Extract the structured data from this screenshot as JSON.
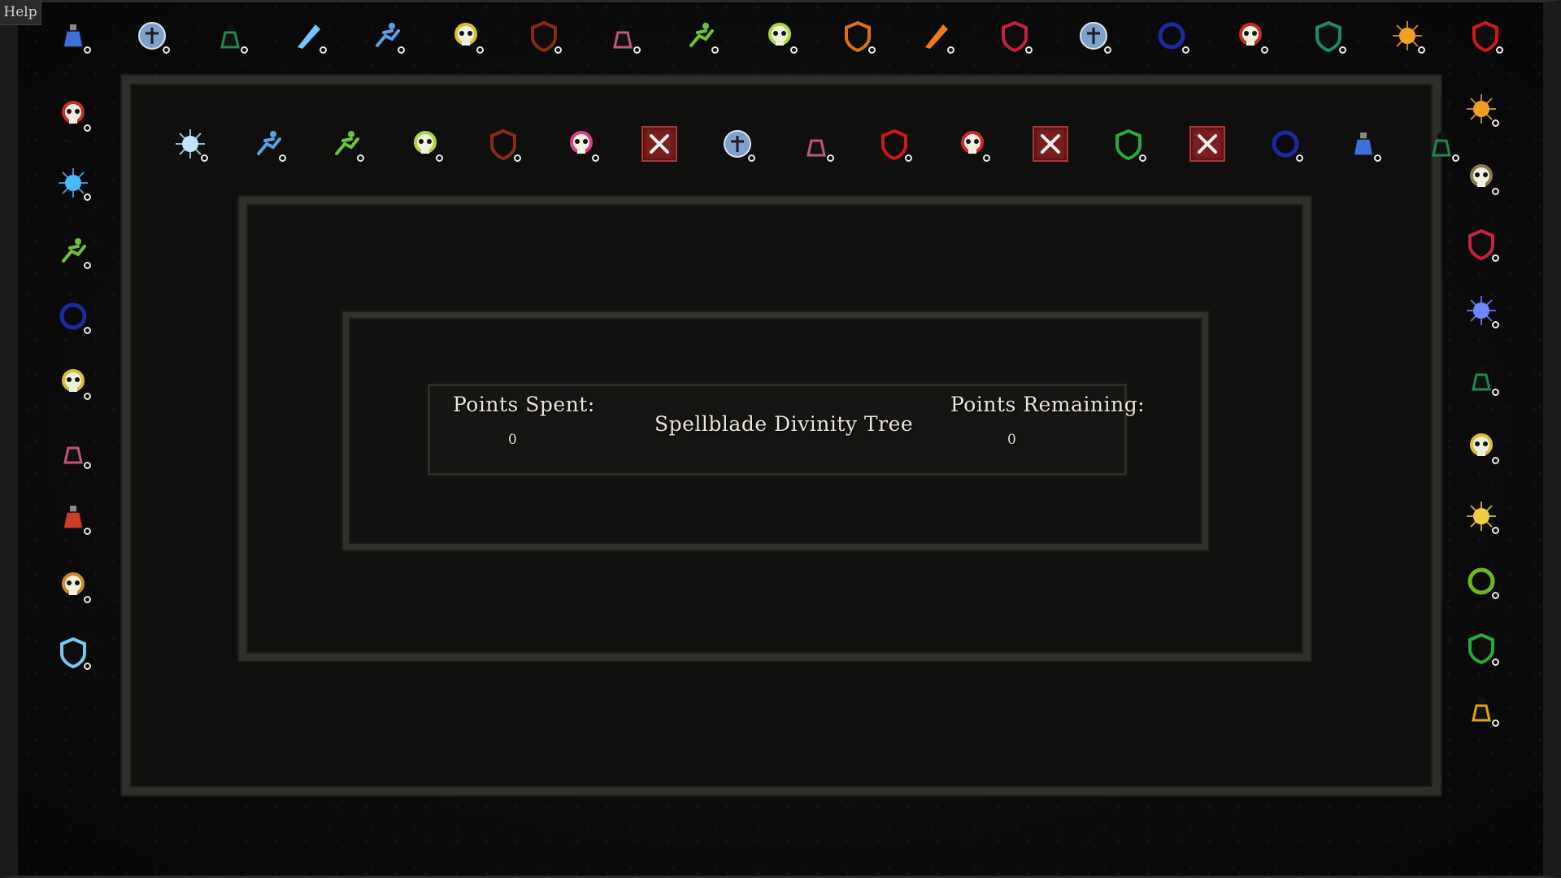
{
  "help_label": "Help",
  "panel": {
    "title": "Spellblade Divinity Tree",
    "points_spent_label": "Points Spent:",
    "points_spent_value": "0",
    "points_remaining_label": "Points Remaining:",
    "points_remaining_value": "0"
  },
  "node_state_value": "0",
  "nodes": [
    {
      "icon": "mana-potion-icon",
      "rank": "0"
    },
    {
      "icon": "blessing-icon",
      "rank": "0"
    },
    {
      "icon": "green-aura-icon",
      "rank": "0"
    },
    {
      "icon": "ice-bolt-icon",
      "rank": "0"
    },
    {
      "icon": "sprint-icon",
      "rank": "0"
    },
    {
      "icon": "yellow-skull-icon",
      "rank": "0"
    },
    {
      "icon": "dark-shield-icon",
      "rank": "0"
    },
    {
      "icon": "spirit-body-icon",
      "rank": "0"
    },
    {
      "icon": "green-sprint-icon",
      "rank": "0"
    },
    {
      "icon": "lime-skull-icon",
      "rank": "0"
    },
    {
      "icon": "orange-shield-icon",
      "rank": "0"
    },
    {
      "icon": "fire-meteor-icon",
      "rank": "0"
    },
    {
      "icon": "blue-red-shield-icon",
      "rank": "0"
    },
    {
      "icon": "blessing-icon",
      "rank": "0"
    },
    {
      "icon": "shadow-ward-icon",
      "rank": "0"
    },
    {
      "icon": "red-skull-icon",
      "rank": "0"
    },
    {
      "icon": "teal-shield-icon",
      "rank": "0"
    },
    {
      "icon": "fire-burst-icon",
      "rank": "0"
    },
    {
      "icon": "red-shield-icon",
      "rank": "0"
    },
    {
      "icon": "red-skull-icon",
      "rank": "0"
    },
    {
      "icon": "blue-flame-icon",
      "rank": "0"
    },
    {
      "icon": "green-sprint-icon",
      "rank": "0"
    },
    {
      "icon": "shadow-ward-icon",
      "rank": "0"
    },
    {
      "icon": "yellow-skull-icon",
      "rank": "0"
    },
    {
      "icon": "spirit-body-icon",
      "rank": "0"
    },
    {
      "icon": "health-potion-icon",
      "rank": "0"
    },
    {
      "icon": "orange-skull-icon",
      "rank": "0"
    },
    {
      "icon": "blue-shield-icon",
      "rank": "0"
    },
    {
      "icon": "fire-burst-icon",
      "rank": "0"
    },
    {
      "icon": "skull-icon",
      "rank": "0"
    },
    {
      "icon": "blue-red-shield-icon",
      "rank": "0"
    },
    {
      "icon": "arcane-orbs-icon",
      "rank": "0"
    },
    {
      "icon": "green-aura-icon",
      "rank": "0"
    },
    {
      "icon": "yellow-skull-icon",
      "rank": "0"
    },
    {
      "icon": "lightning-icon",
      "rank": "0"
    },
    {
      "icon": "green-ring-icon",
      "rank": "0"
    },
    {
      "icon": "green-shield-icon",
      "rank": "0"
    },
    {
      "icon": "golden-body-icon",
      "rank": "0"
    },
    {
      "icon": "frost-nova-icon",
      "rank": "0"
    },
    {
      "icon": "sprint-icon",
      "rank": "0"
    },
    {
      "icon": "green-sprint-icon",
      "rank": "0"
    },
    {
      "icon": "lime-skull-icon",
      "rank": "0"
    },
    {
      "icon": "dark-shield-icon",
      "rank": "0"
    },
    {
      "icon": "pink-skull-icon",
      "rank": "0"
    },
    {
      "icon": "locked-icon",
      "rank": ""
    },
    {
      "icon": "blessing-icon",
      "rank": "0"
    },
    {
      "icon": "spirit-body-icon",
      "rank": "0"
    },
    {
      "icon": "red-shield-icon",
      "rank": "0"
    },
    {
      "icon": "red-skull-icon",
      "rank": "0"
    },
    {
      "icon": "locked-icon",
      "rank": ""
    },
    {
      "icon": "green-shield-icon",
      "rank": "0"
    },
    {
      "icon": "locked-icon",
      "rank": ""
    },
    {
      "icon": "shadow-ward-icon",
      "rank": "0"
    },
    {
      "icon": "mana-potion-icon",
      "rank": "0"
    },
    {
      "icon": "green-aura-icon",
      "rank": "0"
    }
  ]
}
